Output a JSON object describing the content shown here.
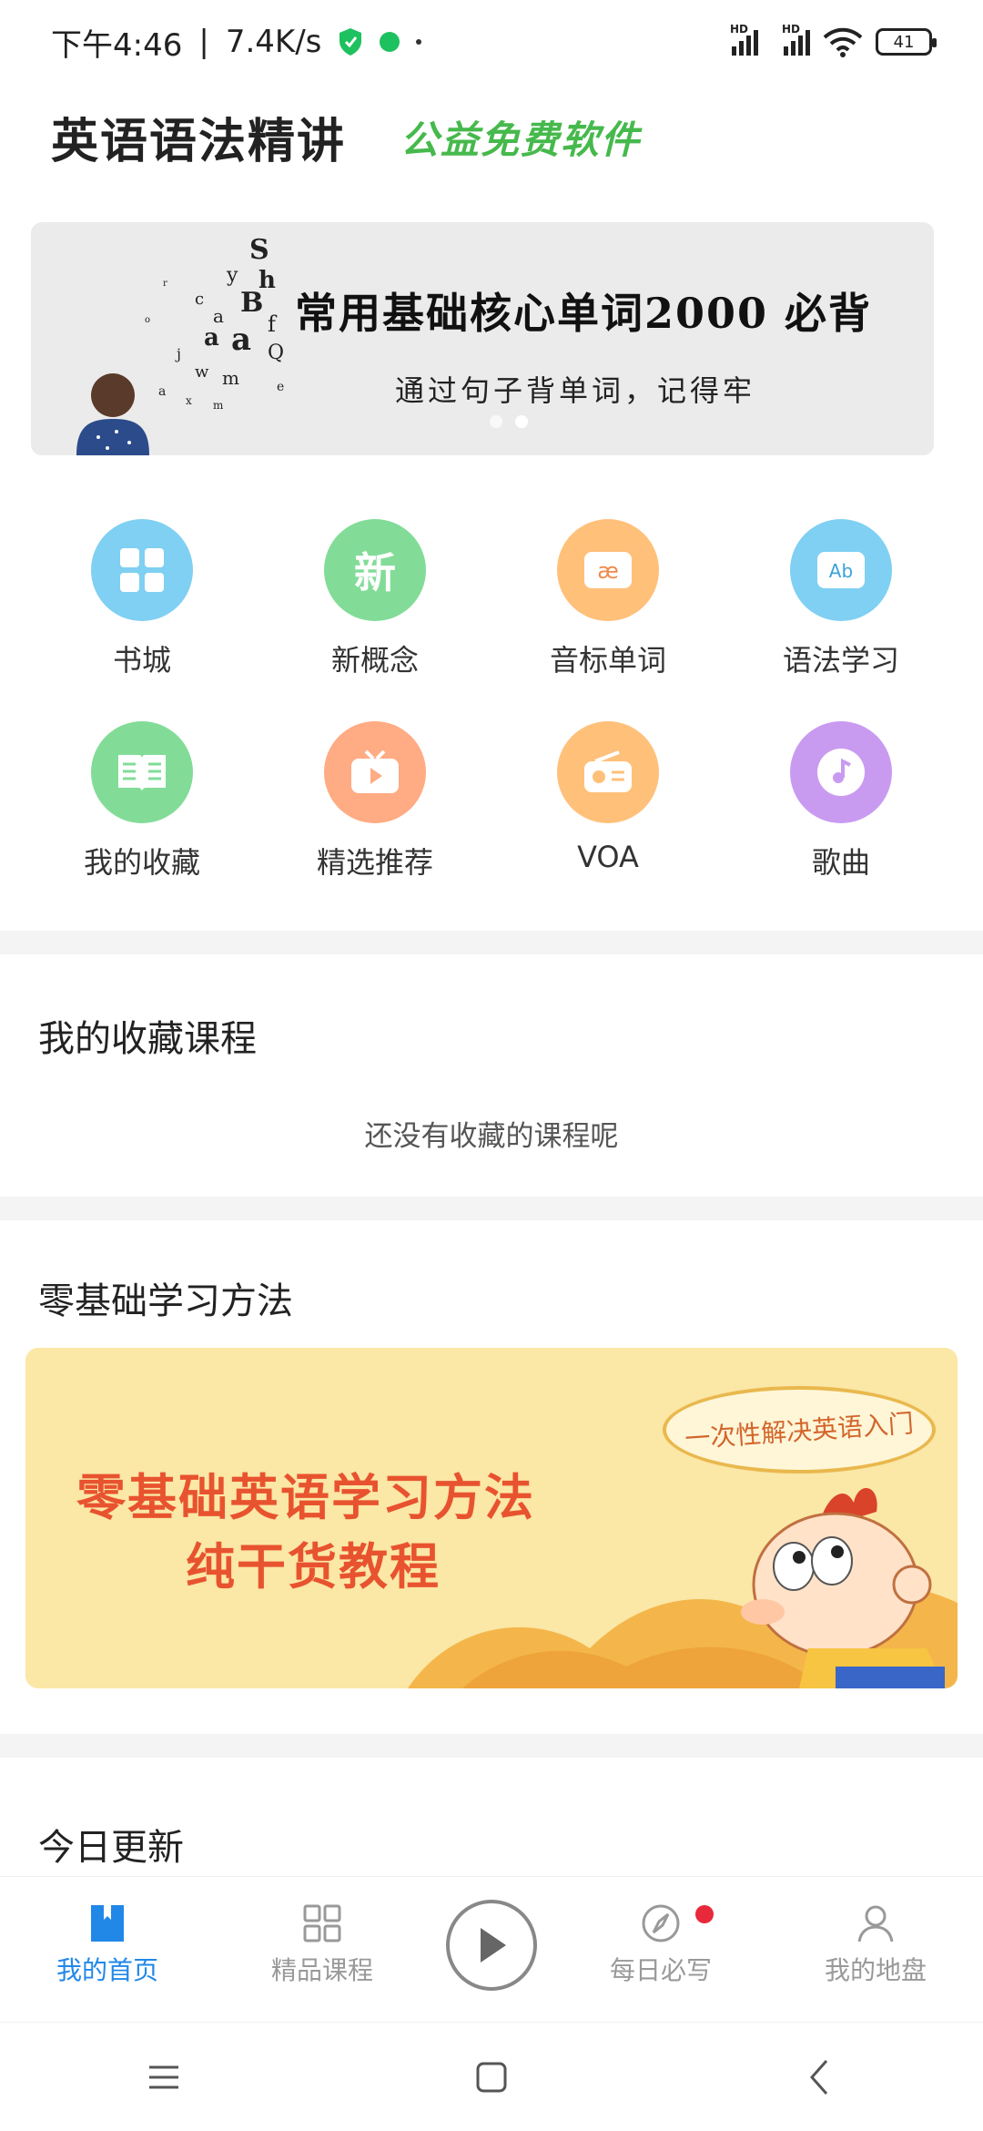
{
  "status": {
    "time": "下午4:46",
    "speed": "7.4K/s",
    "battery": "41",
    "hd1": "HD",
    "hd2": "HD"
  },
  "header": {
    "title": "英语语法精讲",
    "slogan": "公益免费软件"
  },
  "banner": {
    "title": "常用基础核心单词2000 必背",
    "subtitle": "通过句子背单词，记得牢"
  },
  "grid": {
    "items": [
      {
        "label": "书城",
        "icon": "apps-grid-icon",
        "color": "#7fd0f2"
      },
      {
        "label": "新概念",
        "icon": "xin-icon",
        "color": "#82dc98"
      },
      {
        "label": "音标单词",
        "icon": "ae-phonetic-icon",
        "color": "#ffc07a"
      },
      {
        "label": "语法学习",
        "icon": "ab-grammar-icon",
        "color": "#7fd0f2"
      },
      {
        "label": "我的收藏",
        "icon": "book-icon",
        "color": "#82dc98"
      },
      {
        "label": "精选推荐",
        "icon": "video-icon",
        "color": "#ffab84"
      },
      {
        "label": "VOA",
        "icon": "radio-icon",
        "color": "#ffc07a"
      },
      {
        "label": "歌曲",
        "icon": "music-icon",
        "color": "#c99bf0"
      }
    ]
  },
  "favorites": {
    "title": "我的收藏课程",
    "empty": "还没有收藏的课程呢"
  },
  "method": {
    "title": "零基础学习方法",
    "line1": "零基础英语学习方法",
    "line2": "纯干货教程",
    "bubble": "一次性解决英语入门"
  },
  "today": {
    "title": "今日更新"
  },
  "tabbar": {
    "home": "我的首页",
    "courses": "精品课程",
    "daily": "每日必写",
    "disk": "我的地盘",
    "accent": "#2288e8"
  }
}
